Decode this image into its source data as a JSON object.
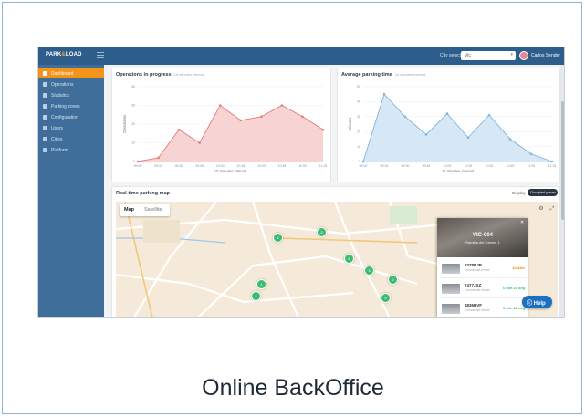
{
  "caption": "Online BackOffice",
  "header": {
    "logo_left": "PARK",
    "logo_mark": "&",
    "logo_right": "LOAD",
    "city_label": "City selected",
    "city_value": "Vic",
    "user_name": "Carlos Sender"
  },
  "sidebar": {
    "items": [
      {
        "label": "Dashboard",
        "active": true
      },
      {
        "label": "Operations",
        "active": false
      },
      {
        "label": "Statistics",
        "active": false
      },
      {
        "label": "Parking zones",
        "active": false
      },
      {
        "label": "Configuration",
        "active": false
      },
      {
        "label": "Users",
        "active": false
      },
      {
        "label": "Cities",
        "active": false
      },
      {
        "label": "Platform",
        "active": false
      }
    ]
  },
  "colors": {
    "topbar": "#2d5d8a",
    "sidebar": "#3f6e9a",
    "active_item": "#f39318",
    "ops_series": "#e8787a",
    "ops_fill": "#f7d3d3",
    "avg_series": "#7fb4dc",
    "avg_fill": "#d6e8f5",
    "pin": "#3dbb6e",
    "help": "#1d6fc2"
  },
  "chart_data": [
    {
      "type": "area",
      "title": "Operations in progress",
      "subtitle": "15 minutes interval",
      "xlabel": "15 minutes interval",
      "ylabel": "Operations",
      "x": [
        "09:00",
        "09:15",
        "09:30",
        "09:45",
        "10:00",
        "10:15",
        "10:30",
        "10:45",
        "11:00",
        "11:15"
      ],
      "values": [
        0,
        2,
        17,
        10,
        30,
        22,
        24,
        30,
        24,
        17
      ],
      "ylim": [
        0,
        40
      ],
      "yticks": [
        0,
        10,
        20,
        30,
        40
      ],
      "grid": true
    },
    {
      "type": "area",
      "title": "Average parking time",
      "subtitle": "15 minutes interval",
      "xlabel": "15 minutes interval",
      "ylabel": "minutes",
      "x": [
        "09:00",
        "09:15",
        "09:30",
        "09:45",
        "10:00",
        "10:15",
        "10:30",
        "10:45",
        "11:00",
        "11:15"
      ],
      "values": [
        0,
        45,
        30,
        18,
        32,
        16,
        31,
        15,
        5,
        0
      ],
      "ylim": [
        0,
        50
      ],
      "yticks": [
        0,
        10,
        20,
        30,
        40,
        50
      ],
      "grid": true
    }
  ],
  "map": {
    "title": "Real-time parking map",
    "display_label": "Display",
    "toggle_on": "Occupied places",
    "toggle_off": "Free spots",
    "tab_map": "Map",
    "tab_satellite": "Satellite",
    "fullscreen_icon": "expand-icon",
    "pins": [
      "4",
      "3",
      "6",
      "3",
      "2",
      "1",
      "4",
      "5"
    ],
    "info_title": "VIC-004",
    "info_address": "Rambla del Carme, 1",
    "vehicles": [
      {
        "plate": "3378BJB",
        "sub": "Commercial vehicle",
        "duration": "1h 44m",
        "status": "orange"
      },
      {
        "plate": "7477JXZ",
        "sub": "Commercial vehicle",
        "duration": "6 min 20 seg",
        "status": "green"
      },
      {
        "plate": "4836HVF",
        "sub": "Commercial vehicle",
        "duration": "6 min 22 seg",
        "status": "green"
      }
    ]
  },
  "help_label": "Help"
}
